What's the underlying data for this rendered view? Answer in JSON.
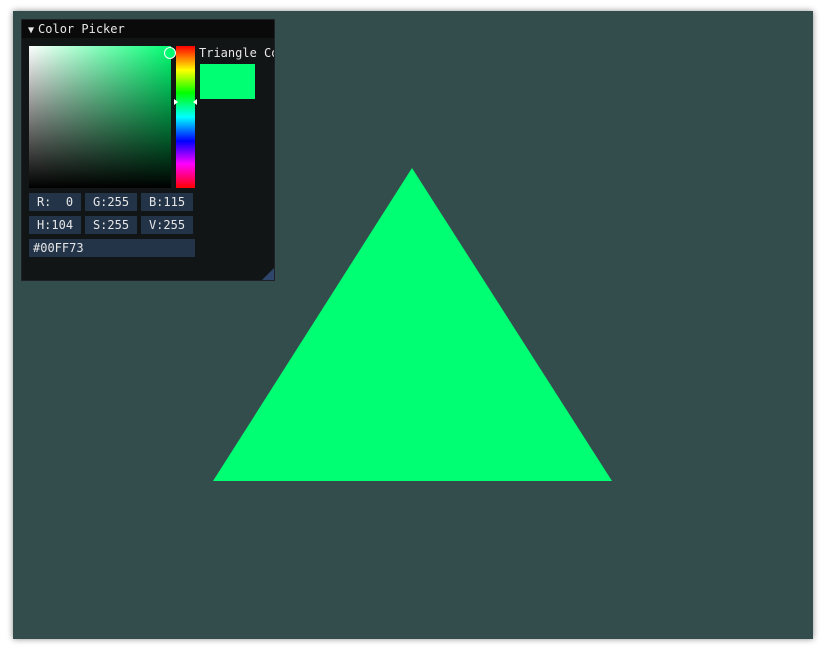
{
  "colors": {
    "background": "#334d4d",
    "triangle": "#00ff73"
  },
  "panel": {
    "title": "Color Picker",
    "collapse_icon": "triangle-down-icon",
    "preview_label": "Triangle Co",
    "hsv_fraction": {
      "saturation": 1.0,
      "value": 1.0,
      "hue": 0.408
    },
    "rgb": {
      "r_label": "R:  0",
      "g_label": "G:255",
      "b_label": "B:115"
    },
    "hsv": {
      "h_label": "H:104",
      "s_label": "S:255",
      "v_label": "V:255"
    },
    "hex": "#00FF73"
  }
}
